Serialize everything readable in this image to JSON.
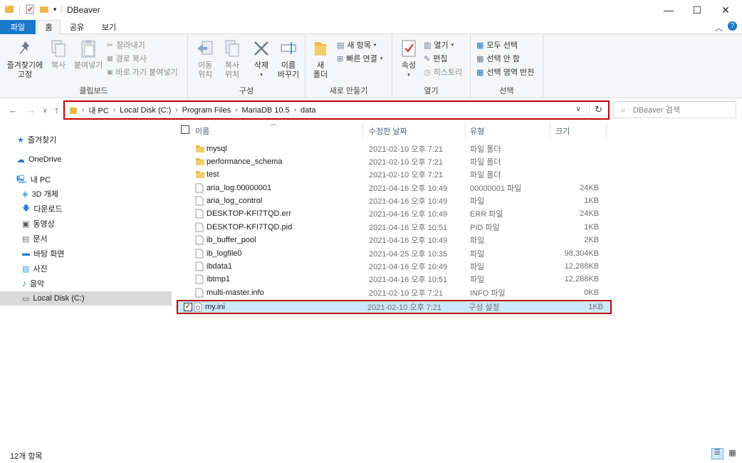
{
  "window": {
    "title": "DBeaver"
  },
  "tabs": {
    "file": "파일",
    "home": "홈",
    "share": "공유",
    "view": "보기"
  },
  "ribbon": {
    "clipboard": {
      "label": "클립보드",
      "pin": "즐겨찾기에\n고정",
      "pin_line1": "즐겨찾기에",
      "pin_line2": "고정",
      "copy": "복사",
      "paste": "붙여넣기",
      "cut": "잘라내기",
      "copy_path": "경로 복사",
      "paste_shortcut": "바로 가기 붙여넣기"
    },
    "organize": {
      "label": "구성",
      "move_line1": "이동",
      "move_line2": "위치",
      "copyto_line1": "복사",
      "copyto_line2": "위치",
      "delete": "삭제",
      "rename_line1": "이름",
      "rename_line2": "바꾸기"
    },
    "new": {
      "label": "새로 만들기",
      "folder_line1": "새",
      "folder_line2": "폴더",
      "new_item": "새 항목",
      "easy_access": "빠른 연결"
    },
    "open": {
      "label": "열기",
      "properties": "속성",
      "open": "열기",
      "edit": "편집",
      "history": "히스토리"
    },
    "select": {
      "label": "선택",
      "select_all": "모두 선택",
      "select_none": "선택 안 함",
      "invert": "선택 영역 반전"
    }
  },
  "address": {
    "crumbs": [
      "내 PC",
      "Local Disk (C:)",
      "Program Files",
      "MariaDB 10.5",
      "data"
    ],
    "search_placeholder": "DBeaver 검색"
  },
  "nav": {
    "items": [
      {
        "label": "즐겨찾기",
        "icon": "star-icon"
      },
      {
        "label": "OneDrive",
        "icon": "cloud-icon"
      },
      {
        "label": "내 PC",
        "icon": "pc-icon"
      },
      {
        "label": "3D 개체",
        "icon": "cube-icon"
      },
      {
        "label": "다운로드",
        "icon": "download-icon"
      },
      {
        "label": "동영상",
        "icon": "video-icon"
      },
      {
        "label": "문서",
        "icon": "document-icon"
      },
      {
        "label": "바탕 화면",
        "icon": "desktop-icon"
      },
      {
        "label": "사진",
        "icon": "picture-icon"
      },
      {
        "label": "음악",
        "icon": "music-icon"
      },
      {
        "label": "Local Disk (C:)",
        "icon": "drive-icon"
      }
    ]
  },
  "columns": {
    "name": "이름",
    "date": "수정한 날짜",
    "type": "유형",
    "size": "크기"
  },
  "files": [
    {
      "name": "mysql",
      "date": "2021-02-10 오후 7:21",
      "type": "파일 폴더",
      "size": "",
      "kind": "folder"
    },
    {
      "name": "performance_schema",
      "date": "2021-02-10 오후 7:21",
      "type": "파일 폴더",
      "size": "",
      "kind": "folder"
    },
    {
      "name": "test",
      "date": "2021-02-10 오후 7:21",
      "type": "파일 폴더",
      "size": "",
      "kind": "folder"
    },
    {
      "name": "aria_log.00000001",
      "date": "2021-04-16 오후 10:49",
      "type": "00000001 파일",
      "size": "24KB",
      "kind": "file"
    },
    {
      "name": "aria_log_control",
      "date": "2021-04-16 오후 10:49",
      "type": "파일",
      "size": "1KB",
      "kind": "file"
    },
    {
      "name": "DESKTOP-KFI7TQD.err",
      "date": "2021-04-16 오후 10:49",
      "type": "ERR 파일",
      "size": "24KB",
      "kind": "file"
    },
    {
      "name": "DESKTOP-KFI7TQD.pid",
      "date": "2021-04-16 오후 10:51",
      "type": "PID 파일",
      "size": "1KB",
      "kind": "file"
    },
    {
      "name": "ib_buffer_pool",
      "date": "2021-04-16 오후 10:49",
      "type": "파일",
      "size": "2KB",
      "kind": "file"
    },
    {
      "name": "ib_logfile0",
      "date": "2021-04-25 오후 10:35",
      "type": "파일",
      "size": "98,304KB",
      "kind": "file"
    },
    {
      "name": "ibdata1",
      "date": "2021-04-16 오후 10:49",
      "type": "파일",
      "size": "12,288KB",
      "kind": "file"
    },
    {
      "name": "ibtmp1",
      "date": "2021-04-16 오후 10:51",
      "type": "파일",
      "size": "12,288KB",
      "kind": "file"
    },
    {
      "name": "multi-master.info",
      "date": "2021-02-10 오후 7:21",
      "type": "INFO 파일",
      "size": "0KB",
      "kind": "file"
    },
    {
      "name": "my.ini",
      "date": "2021-02-10 오후 7:21",
      "type": "구성 설정",
      "size": "1KB",
      "kind": "ini",
      "selected": true
    }
  ],
  "status": {
    "count": "12개 항목"
  },
  "colors": {
    "accent": "#1979ca",
    "highlight": "#c00000",
    "selection": "#cce8ff",
    "folder": "#e8b84a"
  }
}
